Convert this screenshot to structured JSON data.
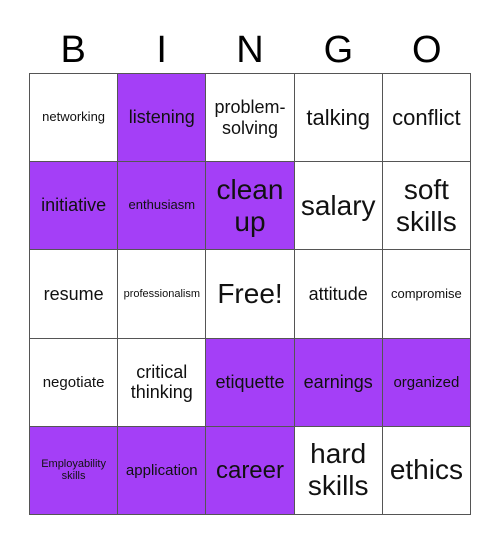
{
  "header": [
    "B",
    "I",
    "N",
    "G",
    "O"
  ],
  "mark_color": "#A43FF7",
  "cells": [
    {
      "text": "networking",
      "marked": false,
      "size": "s2"
    },
    {
      "text": "listening",
      "marked": true,
      "size": "s4"
    },
    {
      "text": "problem-solving",
      "marked": false,
      "size": "s4"
    },
    {
      "text": "talking",
      "marked": false,
      "size": "s5"
    },
    {
      "text": "conflict",
      "marked": false,
      "size": "s5"
    },
    {
      "text": "initiative",
      "marked": true,
      "size": "s4"
    },
    {
      "text": "enthusiasm",
      "marked": true,
      "size": "s2"
    },
    {
      "text": "clean up",
      "marked": true,
      "size": "s6"
    },
    {
      "text": "salary",
      "marked": false,
      "size": "s6"
    },
    {
      "text": "soft skills",
      "marked": false,
      "size": "s6"
    },
    {
      "text": "resume",
      "marked": false,
      "size": "s4"
    },
    {
      "text": "professionalism",
      "marked": false,
      "size": "s1"
    },
    {
      "text": "Free!",
      "marked": false,
      "size": "s6"
    },
    {
      "text": "attitude",
      "marked": false,
      "size": "s4"
    },
    {
      "text": "compromise",
      "marked": false,
      "size": "s2"
    },
    {
      "text": "negotiate",
      "marked": false,
      "size": "s3"
    },
    {
      "text": "critical thinking",
      "marked": false,
      "size": "s4"
    },
    {
      "text": "etiquette",
      "marked": true,
      "size": "s4"
    },
    {
      "text": "earnings",
      "marked": true,
      "size": "s4"
    },
    {
      "text": "organized",
      "marked": true,
      "size": "s3"
    },
    {
      "text": "Employability skills",
      "marked": true,
      "size": "s1"
    },
    {
      "text": "application",
      "marked": true,
      "size": "s3"
    },
    {
      "text": "career",
      "marked": true,
      "size": "s7"
    },
    {
      "text": "hard skills",
      "marked": false,
      "size": "s6"
    },
    {
      "text": "ethics",
      "marked": false,
      "size": "s6"
    }
  ]
}
